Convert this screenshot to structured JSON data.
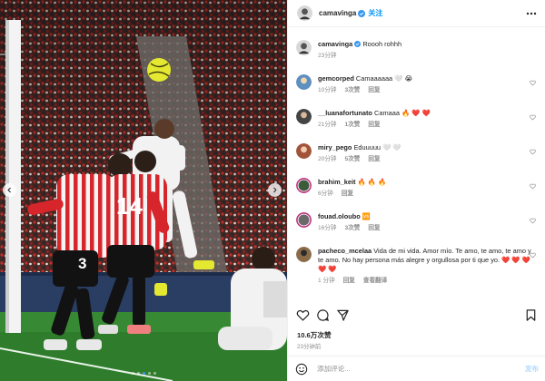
{
  "post": {
    "username": "camavinga",
    "follow_label": "关注",
    "caption": "Roooh rohhh",
    "caption_time": "23分钟",
    "likes": "10.6万次赞",
    "posted_ago": "23分钟前"
  },
  "comments": [
    {
      "user": "gemcorped",
      "text": "Camaaaaaa 🤍 😭",
      "time": "10分钟",
      "likes": "3次赞",
      "reply": "回复"
    },
    {
      "user": "__luanafortunato",
      "text": "Camaaa 🔥 ❤️ ❤️",
      "time": "21分钟",
      "likes": "1次赞",
      "reply": "回复"
    },
    {
      "user": "miry_pego",
      "text": "Eduuuuu 🤍 🤍",
      "time": "20分钟",
      "likes": "5次赞",
      "reply": "回复"
    },
    {
      "user": "brahim_keit",
      "text": "🔥 🔥 🔥",
      "time": "6分钟",
      "likes": "",
      "reply": "回复"
    },
    {
      "user": "fouad.oloubo",
      "text": "🆚",
      "time": "16分钟",
      "likes": "3次赞",
      "reply": "回复"
    },
    {
      "user": "pacheco_mcelaa",
      "text": "Vida de mi vida. Amor mío. Te amo, te amo, te amo y te amo. No hay persona más alegre y orgullosa por ti que yo. ❤️ ❤️ ❤️ ❤️ ❤️",
      "time": "1 分钟",
      "likes": "",
      "reply": "回复",
      "translate": "查看翻译"
    }
  ],
  "compose": {
    "placeholder": "添加评论...",
    "post_label": "发布"
  },
  "shirt_numbers": {
    "left_player": "3",
    "right_player": "14"
  },
  "colors": {
    "accent": "#0095f6",
    "verified": "#3897f0",
    "athletic_red": "#d6262c",
    "real_white": "#f2f2f2",
    "ball": "#e4e830"
  },
  "icons": [
    "more-icon",
    "verified-icon",
    "heart-icon",
    "comment-icon",
    "share-icon",
    "save-icon",
    "emoji-icon",
    "chevron-left-icon",
    "chevron-right-icon"
  ]
}
